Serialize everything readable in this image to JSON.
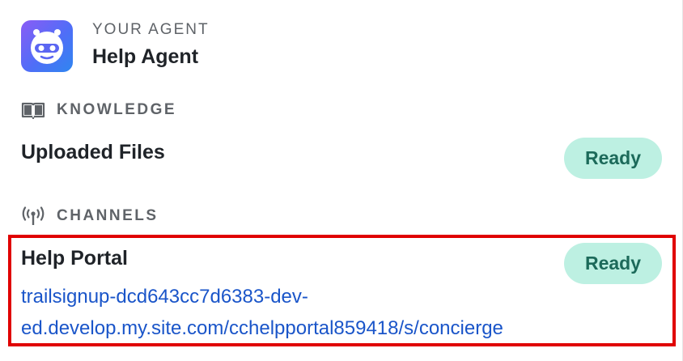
{
  "agent": {
    "eyebrow": "YOUR AGENT",
    "name": "Help Agent",
    "avatar_icon": "robot-face-icon",
    "avatar_colors": [
      "#8a5cf6",
      "#4f6ef7",
      "#2f86f0"
    ]
  },
  "knowledge": {
    "heading": "KNOWLEDGE",
    "icon": "book-icon",
    "items": [
      {
        "title": "Uploaded Files",
        "status": "Ready"
      }
    ]
  },
  "channels": {
    "heading": "CHANNELS",
    "icon": "broadcast-antenna-icon",
    "items": [
      {
        "title": "Help Portal",
        "status": "Ready",
        "url_line1": "trailsignup-dcd643cc7d6383-dev-",
        "url_line2": "ed.develop.my.site.com/cchelpportal859418/s/concierge"
      }
    ]
  },
  "colors": {
    "ready_pill_bg": "#bdf0e2",
    "ready_pill_text": "#1c6a5a",
    "link": "#1a55c9",
    "highlight_border": "#e00000"
  }
}
